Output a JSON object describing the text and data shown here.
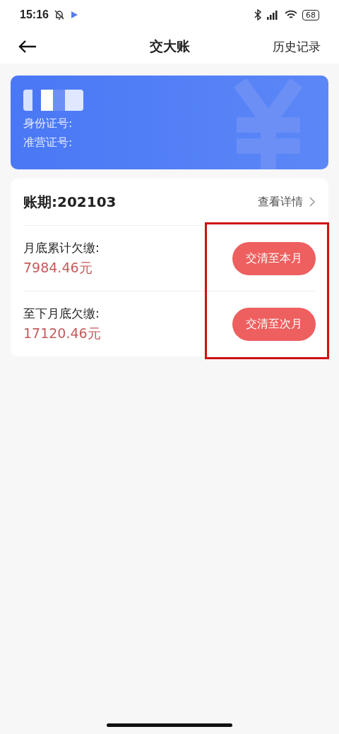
{
  "status_bar": {
    "time": "15:16",
    "battery": "68"
  },
  "header": {
    "title": "交大账",
    "action": "历史记录"
  },
  "id_card": {
    "fields": [
      {
        "label": "身份证号:"
      },
      {
        "label": "准营证号:"
      }
    ]
  },
  "bill": {
    "period": "账期:202103",
    "details_link": "查看详情",
    "rows": [
      {
        "label": "月底累计欠缴:",
        "amount": "7984.46元",
        "button": "交清至本月"
      },
      {
        "label": "至下月底欠缴:",
        "amount": "17120.46元",
        "button": "交清至次月"
      }
    ],
    "highlighted": true
  }
}
